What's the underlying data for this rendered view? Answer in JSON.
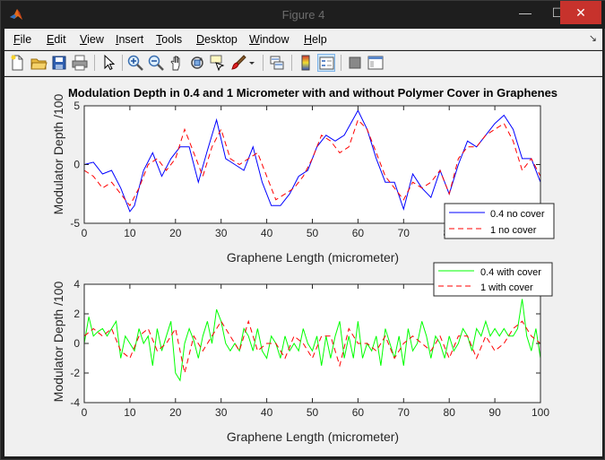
{
  "window": {
    "title": "Figure 4",
    "controls": {
      "minimize": "—",
      "maximize": "☐",
      "close": "✕"
    }
  },
  "menu": [
    {
      "label": "File",
      "key": "F",
      "rest": "ile"
    },
    {
      "label": "Edit",
      "key": "E",
      "rest": "dit"
    },
    {
      "label": "View",
      "key": "V",
      "rest": "iew"
    },
    {
      "label": "Insert",
      "key": "I",
      "rest": "nsert"
    },
    {
      "label": "Tools",
      "key": "T",
      "rest": "ools"
    },
    {
      "label": "Desktop",
      "key": "D",
      "rest": "esktop"
    },
    {
      "label": "Window",
      "key": "W",
      "rest": "indow"
    },
    {
      "label": "Help",
      "key": "H",
      "rest": "elp"
    }
  ],
  "toolbar": {
    "icons": [
      "new-figure-icon",
      "open-file-icon",
      "save-icon",
      "print-icon",
      "edit-plot-icon",
      "zoom-in-icon",
      "zoom-out-icon",
      "pan-icon",
      "rotate-3d-icon",
      "data-cursor-icon",
      "brush-icon",
      "link-plot-icon",
      "colorbar-icon",
      "legend-icon",
      "hide-plot-tools-icon",
      "show-plot-tools-icon"
    ]
  },
  "colors": {
    "blue_series": "#0000ff",
    "red_series": "#ff0000",
    "green_series": "#00ff00",
    "figure_bg": "#f0f0f0",
    "axes_bg": "#ffffff"
  },
  "chart_data": [
    {
      "type": "line",
      "title": "Modulation Depth in 0.4 and 1 Micrometer with and without Polymer Cover in Graphenes",
      "xlabel": "Graphene Length (micrometer)",
      "ylabel": "Modulator Depth /100",
      "xlim": [
        0,
        100
      ],
      "ylim": [
        -5,
        5
      ],
      "xticks": [
        "0",
        "10",
        "20",
        "30",
        "40",
        "50",
        "60",
        "70",
        "80",
        "90",
        "100"
      ],
      "yticks": [
        "-5",
        "0",
        "5"
      ],
      "legend_position": "bottom-right",
      "series": [
        {
          "name": "0.4 no cover",
          "color": "#0000ff",
          "dash": "solid",
          "x": [
            0,
            2,
            4,
            6,
            8,
            10,
            11,
            13,
            15,
            17,
            19,
            21,
            23,
            25,
            27,
            29,
            31,
            33,
            35,
            37,
            39,
            41,
            43,
            45,
            47,
            49,
            51,
            53,
            55,
            57,
            60,
            62,
            64,
            66,
            68,
            70,
            72,
            74,
            76,
            78,
            80,
            82,
            84,
            86,
            88,
            90,
            92,
            94,
            96,
            98,
            100
          ],
          "y": [
            0,
            0.2,
            -0.8,
            -0.5,
            -2,
            -4,
            -3.5,
            -0.5,
            1,
            -1,
            0.5,
            1.5,
            1.5,
            -1.5,
            1.2,
            3.8,
            0.5,
            0,
            -0.5,
            1.5,
            -1.5,
            -3.5,
            -3.5,
            -2.5,
            -1,
            -0.5,
            1.5,
            2.5,
            2,
            2.5,
            4.6,
            3,
            0.5,
            -1.5,
            -1.5,
            -3.8,
            -0.8,
            -2,
            -2.8,
            -0.5,
            -2.5,
            0,
            2,
            1.5,
            2.5,
            3.5,
            4.2,
            3,
            0.5,
            0.5,
            -1.5
          ]
        },
        {
          "name": "1 no cover",
          "color": "#ff0000",
          "dash": "dashed",
          "x": [
            0,
            2,
            4,
            6,
            8,
            10,
            12,
            14,
            16,
            18,
            20,
            22,
            24,
            26,
            28,
            30,
            32,
            34,
            36,
            38,
            40,
            42,
            44,
            46,
            48,
            50,
            52,
            54,
            56,
            58,
            60,
            62,
            64,
            66,
            68,
            70,
            72,
            74,
            76,
            78,
            80,
            82,
            84,
            86,
            88,
            90,
            92,
            94,
            96,
            98,
            100
          ],
          "y": [
            -0.5,
            -1,
            -2,
            -1.5,
            -2.5,
            -3.5,
            -2,
            0,
            0.5,
            -0.5,
            0.5,
            3,
            1,
            -1,
            1.5,
            3,
            0.5,
            0,
            0.5,
            1,
            -1,
            -3,
            -2.5,
            -2,
            -1,
            0.5,
            2.5,
            2,
            1,
            1.5,
            3.8,
            3,
            1,
            -1,
            -2,
            -3,
            -1.5,
            -2,
            -1.5,
            -0.5,
            -2.5,
            0.5,
            1.5,
            1.5,
            2.5,
            3,
            3.5,
            2,
            -0.5,
            0.5,
            -1
          ]
        }
      ]
    },
    {
      "type": "line",
      "title": "",
      "xlabel": "Graphene Length (micrometer)",
      "ylabel": "Modulator Depth /100",
      "xlim": [
        0,
        100
      ],
      "ylim": [
        -4,
        4
      ],
      "xticks": [
        "0",
        "10",
        "20",
        "30",
        "40",
        "50",
        "60",
        "70",
        "80",
        "90",
        "100"
      ],
      "yticks": [
        "-4",
        "-2",
        "0",
        "2",
        "4"
      ],
      "legend_position": "top-right",
      "series": [
        {
          "name": "0.4 with cover",
          "color": "#00ff00",
          "dash": "solid",
          "x": [
            0,
            1,
            2,
            3,
            4,
            5,
            6,
            7,
            8,
            9,
            10,
            11,
            12,
            13,
            14,
            15,
            16,
            17,
            18,
            19,
            20,
            21,
            22,
            23,
            24,
            25,
            26,
            27,
            28,
            29,
            30,
            31,
            32,
            33,
            34,
            35,
            36,
            37,
            38,
            39,
            40,
            41,
            42,
            43,
            44,
            45,
            46,
            47,
            48,
            49,
            50,
            51,
            52,
            53,
            54,
            55,
            56,
            57,
            58,
            59,
            60,
            61,
            62,
            63,
            64,
            65,
            66,
            67,
            68,
            69,
            70,
            71,
            72,
            73,
            74,
            75,
            76,
            77,
            78,
            79,
            80,
            81,
            82,
            83,
            84,
            85,
            86,
            87,
            88,
            89,
            90,
            91,
            92,
            93,
            94,
            95,
            96,
            97,
            98,
            99,
            100
          ],
          "y": [
            0,
            1.8,
            0.5,
            0.8,
            1,
            0.5,
            1,
            1.5,
            -1,
            0.5,
            0,
            -0.5,
            1,
            0,
            0.5,
            -1.5,
            1,
            -0.5,
            0.5,
            1.5,
            -2,
            -2.5,
            0,
            1,
            0.2,
            -1,
            0.5,
            1.5,
            0,
            2.3,
            1.5,
            0,
            -0.5,
            0,
            -0.5,
            1,
            0.5,
            -0.5,
            1,
            -0.5,
            -1,
            0.5,
            0,
            -1,
            0.5,
            -0.5,
            0,
            -0.5,
            1,
            0,
            -0.5,
            0.5,
            -1.5,
            0.5,
            -1,
            0.5,
            1.5,
            -1,
            0.5,
            -1,
            1.5,
            -1,
            0,
            -0.5,
            0.5,
            -1.5,
            1,
            0,
            -1,
            0.5,
            -1.5,
            1,
            -0.5,
            0,
            1.5,
            0.5,
            -1,
            0.5,
            0,
            -1,
            0.5,
            -0.5,
            0,
            1,
            0.5,
            -0.5,
            1,
            0.5,
            1.5,
            0.5,
            1,
            0.5,
            1,
            0.5,
            0.5,
            1,
            3,
            0.5,
            -0.5,
            1,
            -1
          ]
        },
        {
          "name": "1 with cover",
          "color": "#ff0000",
          "dash": "dashed",
          "x": [
            0,
            2,
            4,
            6,
            8,
            10,
            12,
            14,
            16,
            18,
            20,
            22,
            24,
            26,
            28,
            30,
            32,
            34,
            36,
            38,
            40,
            42,
            44,
            46,
            48,
            50,
            52,
            54,
            56,
            58,
            60,
            62,
            64,
            66,
            68,
            70,
            72,
            74,
            76,
            78,
            80,
            82,
            84,
            86,
            88,
            90,
            92,
            94,
            96,
            98,
            100
          ],
          "y": [
            0.5,
            1,
            0.5,
            1,
            -0.5,
            -1,
            0.5,
            1,
            -0.5,
            0,
            1,
            -2,
            0.5,
            -0.5,
            0.5,
            1.5,
            0.5,
            -0.5,
            1.5,
            -0.5,
            0,
            0,
            -1,
            0.5,
            0,
            -1,
            0.5,
            0.5,
            -1.5,
            1,
            0,
            0,
            -0.5,
            0.5,
            -1,
            0,
            0.5,
            0,
            -0.5,
            0.5,
            -1,
            0.5,
            0.5,
            -1,
            0.5,
            -0.5,
            0,
            1,
            1.5,
            0.5,
            0
          ]
        }
      ]
    }
  ]
}
